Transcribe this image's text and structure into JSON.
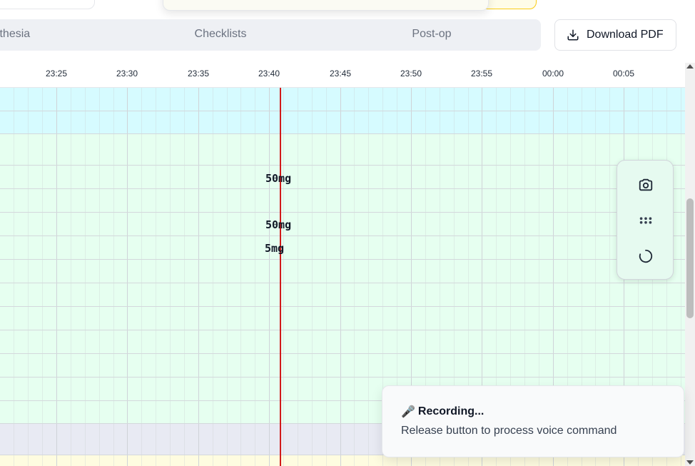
{
  "tabs": [
    {
      "label": "Anesthesia"
    },
    {
      "label": "Checklists"
    },
    {
      "label": "Post-op"
    }
  ],
  "download_button": {
    "label": "Download PDF",
    "icon": "download-icon"
  },
  "timeline": {
    "ticks": [
      "23:25",
      "23:30",
      "23:35",
      "23:40",
      "23:45",
      "23:50",
      "23:55",
      "00:00",
      "00:05"
    ],
    "current_time_line_color": "#d11a1a"
  },
  "doses": [
    {
      "label": "50mg"
    },
    {
      "label": "50mg"
    },
    {
      "label": "5mg"
    }
  ],
  "floating_tools": [
    {
      "icon": "camera-icon"
    },
    {
      "icon": "dots-grid-icon"
    },
    {
      "icon": "loading-spinner-icon"
    }
  ],
  "toast": {
    "icon": "🎤",
    "title": "Recording...",
    "description": "Release button to process voice command"
  },
  "colors": {
    "band_cyan": "#d6fbff",
    "band_green": "#e6fff0",
    "band_gray": "#e8eaf3",
    "band_yellow": "#fefce0"
  }
}
